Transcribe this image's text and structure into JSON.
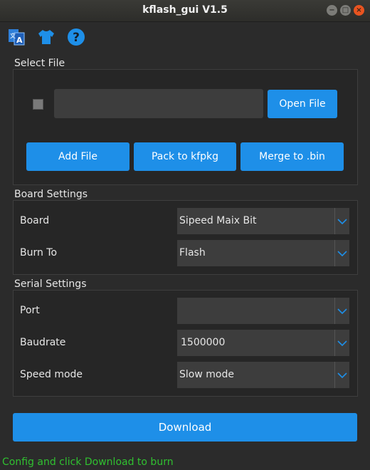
{
  "window": {
    "title": "kflash_gui V1.5"
  },
  "toolbar": {
    "icons": [
      "language-icon",
      "skin-icon",
      "help-icon"
    ]
  },
  "select_file": {
    "section_title": "Select File",
    "file_path": "",
    "open_file_label": "Open File",
    "add_file_label": "Add File",
    "pack_label": "Pack to kfpkg",
    "merge_label": "Merge to .bin"
  },
  "board_settings": {
    "section_title": "Board Settings",
    "board_label": "Board",
    "board_value": "Sipeed Maix Bit",
    "burn_to_label": "Burn To",
    "burn_to_value": "Flash"
  },
  "serial_settings": {
    "section_title": "Serial Settings",
    "port_label": "Port",
    "port_value": "",
    "baudrate_label": "Baudrate",
    "baudrate_value": "1500000",
    "speed_mode_label": "Speed mode",
    "speed_mode_value": "Slow mode"
  },
  "download": {
    "label": "Download"
  },
  "status": {
    "text": "Config and click Download to burn"
  },
  "colors": {
    "accent": "#1e8fe8",
    "status_text": "#30c030",
    "background": "#2b2b2b"
  }
}
